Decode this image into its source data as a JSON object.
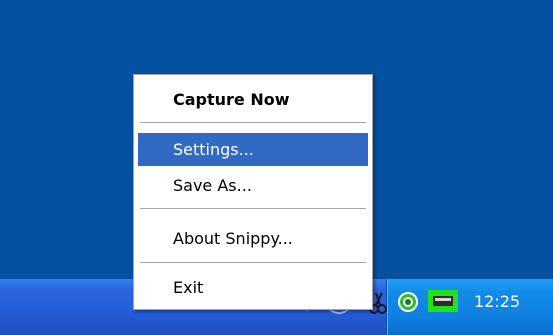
{
  "menu": {
    "items": [
      {
        "label": "Capture Now",
        "bold": true,
        "selected": false
      },
      {
        "label": "Settings...",
        "bold": false,
        "selected": true
      },
      {
        "label": "Save As...",
        "bold": false,
        "selected": false
      },
      {
        "label": "About Snippy...",
        "bold": false,
        "selected": false
      },
      {
        "label": "Exit",
        "bold": false,
        "selected": false
      }
    ]
  },
  "tray": {
    "clock": "12:25",
    "icons": [
      "speaker-icon",
      "arrow-icon",
      "scissors-icon",
      "target-icon",
      "network-icon"
    ]
  },
  "colors": {
    "desktop": "#0650a2",
    "selection": "#316ac5",
    "tray": "#128be8",
    "taskbar": "#245dd8"
  }
}
